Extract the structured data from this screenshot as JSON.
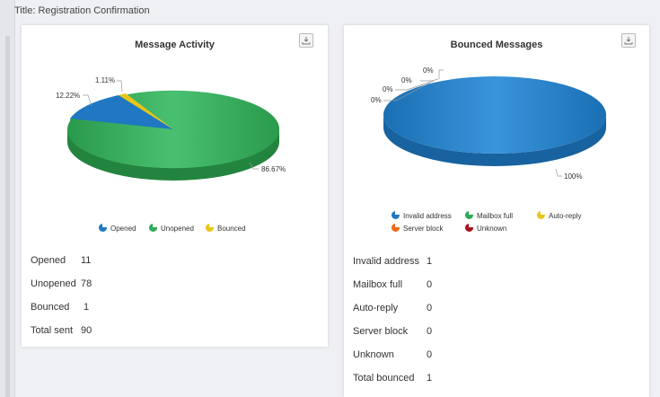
{
  "page": {
    "title": "Title: Registration Confirmation"
  },
  "activity": {
    "title": "Message Activity",
    "labels": {
      "opened": "12.22%",
      "bounced": "1.11%",
      "unopened": "86.67%"
    },
    "legend": [
      {
        "label": "Opened",
        "color": "#1f78c1"
      },
      {
        "label": "Unopened",
        "color": "#2eaa55"
      },
      {
        "label": "Bounced",
        "color": "#e8c51a"
      }
    ],
    "stats": [
      {
        "label": "Opened",
        "value": "11"
      },
      {
        "label": "Unopened",
        "value": "78"
      },
      {
        "label": "Bounced",
        "value": "1"
      },
      {
        "label": "Total sent",
        "value": "90"
      }
    ]
  },
  "bounced": {
    "title": "Bounced Messages",
    "labels": {
      "l1": "0%",
      "l2": "0%",
      "l3": "0%",
      "l4": "0%",
      "main": "100%"
    },
    "legend": [
      {
        "label": "Invalid address",
        "color": "#1f78c1"
      },
      {
        "label": "Mailbox full",
        "color": "#2eaa55"
      },
      {
        "label": "Auto-reply",
        "color": "#e8c51a"
      },
      {
        "label": "Server block",
        "color": "#e86a1a"
      },
      {
        "label": "Unknown",
        "color": "#a8141c"
      }
    ],
    "stats": [
      {
        "label": "Invalid address",
        "value": "1"
      },
      {
        "label": "Mailbox full",
        "value": "0"
      },
      {
        "label": "Auto-reply",
        "value": "0"
      },
      {
        "label": "Server block",
        "value": "0"
      },
      {
        "label": "Unknown",
        "value": "0"
      },
      {
        "label": "Total bounced",
        "value": "1"
      }
    ]
  }
}
